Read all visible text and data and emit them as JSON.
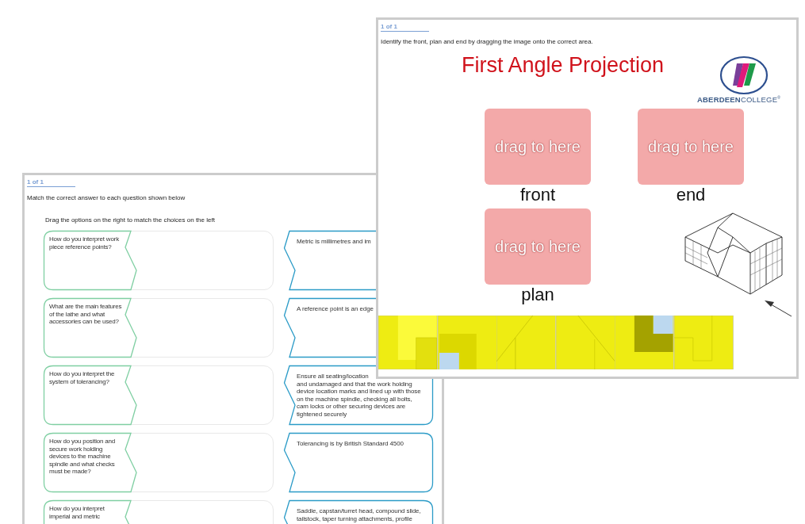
{
  "left_window": {
    "page_indicator": "1 of 1",
    "instruction": "Match the correct answer to each question shown below",
    "sub_instruction": "Drag the options on the right to match the choices on the left",
    "pairs": [
      {
        "question": "How do you interpret work piece reference points?",
        "answer": "Metric is millimetres and im"
      },
      {
        "question": "What are the main features of the lathe and what accessories can be used?",
        "answer": "A reference point is an edge"
      },
      {
        "question": "How do you interpret the system of tolerancing?",
        "answer": "Ensure all seating/location\nand undamaged and that the work holding device location marks and lined up with those on the machine spindle, checking all bolts, cam locks or other securing devices are tightened securely"
      },
      {
        "question": "How do you position and secure work holding devices to the machine spindle and what checks must be made?",
        "answer": "Tolerancing is by British Standard 4500"
      },
      {
        "question": "How do you interpret imperial and metric",
        "answer": "Saddle, capstan/turret head, compound slide,\ntailstock, taper turning attachments, profile"
      }
    ]
  },
  "right_window": {
    "page_indicator": "1 of 1",
    "instruction": "Identify the front, plan and end by dragging the image onto the correct area.",
    "title": "First Angle Projection",
    "logo_text": "**ABERDEEN**COLLEGE$^{®}$",
    "drop_zones": [
      {
        "hint": "drag to here",
        "label": "front"
      },
      {
        "hint": "drag to here",
        "label": "end"
      },
      {
        "hint": "drag to here",
        "label": "plan"
      }
    ]
  }
}
